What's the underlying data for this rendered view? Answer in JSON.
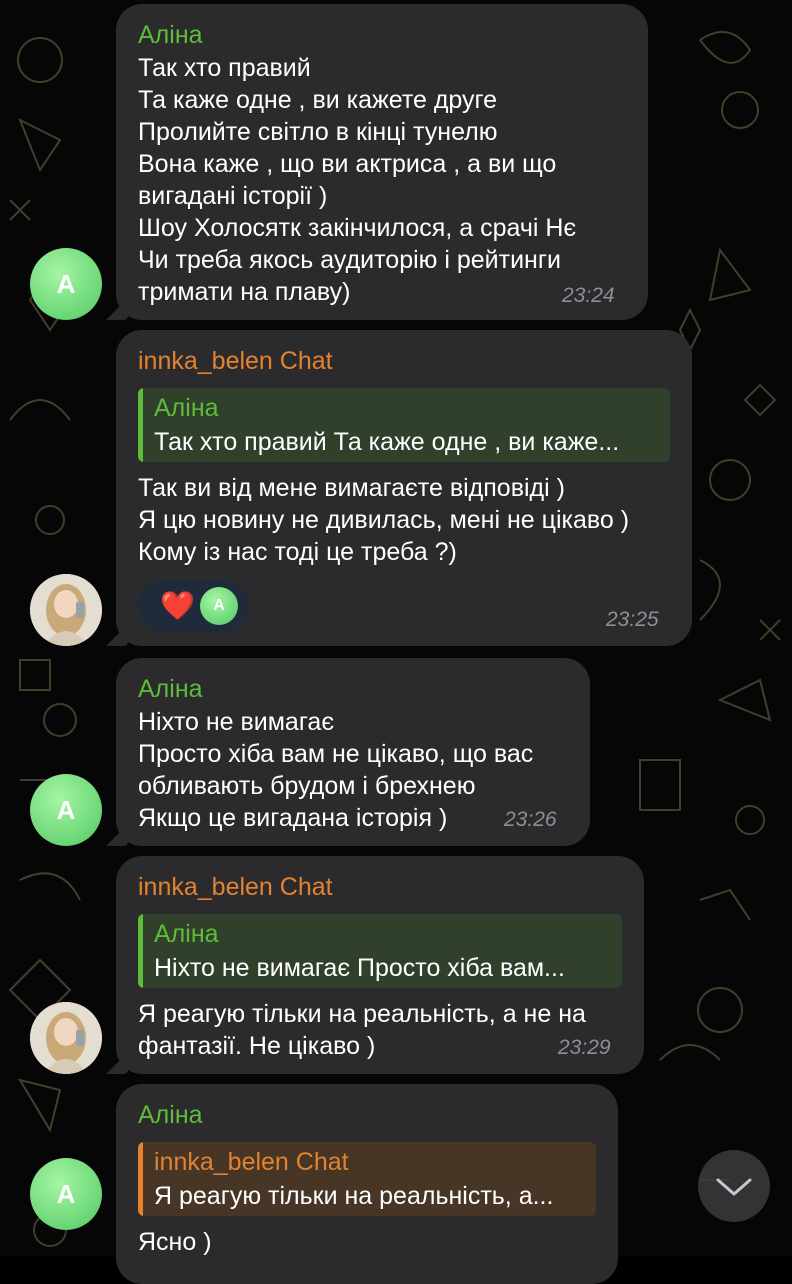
{
  "messages": [
    {
      "sender": "Аліна",
      "lines": [
        "Так хто правий",
        "Та каже одне , ви кажете друге",
        "Пролийте світло в кінці тунелю",
        "Вона каже , що ви актриса , а ви що",
        "вигадані історії )",
        "Шоу Холосятк  закінчилося, а срачі Нє",
        "Чи треба якось аудиторію і рейтинги",
        "тримати на плаву)"
      ],
      "time": "23:24",
      "avatar_letter": "A"
    },
    {
      "sender": "innka_belen Chat",
      "reply": {
        "name": "Аліна",
        "text": "Так хто правий Та каже одне , ви каже..."
      },
      "lines": [
        "Так ви від мене вимагаєте відповіді )",
        "Я цю новину не дивилась, мені не цікаво )",
        "Кому із нас тоді це треба ?)"
      ],
      "reaction": {
        "emoji": "❤️",
        "avatar_letter": "A"
      },
      "time": "23:25"
    },
    {
      "sender": "Аліна",
      "lines": [
        "Ніхто не вимагає",
        "Просто хіба вам не цікаво, що вас",
        "обливають брудом і брехнею",
        "Якщо це вигадана історія )"
      ],
      "time": "23:26",
      "avatar_letter": "A"
    },
    {
      "sender": "innka_belen Chat",
      "reply": {
        "name": "Аліна",
        "text": "Ніхто не вимагає  Просто хіба вам..."
      },
      "lines": [
        "Я реагую тільки на реальність, а не на",
        "фантазії. Не цікаво )"
      ],
      "time": "23:29"
    },
    {
      "sender": "Аліна",
      "reply": {
        "name": "innka_belen Chat",
        "text": "Я реагую тільки на реальність, а..."
      },
      "lines": [
        "Ясно )"
      ],
      "avatar_letter": "A"
    }
  ],
  "colors": {
    "bubble": "#2b2b2d",
    "sender_alina": "#5fbb3a",
    "sender_innka": "#e3822f",
    "time": "#8e8e93"
  },
  "icons": {
    "scroll_down": "chevron-down-icon",
    "heart": "heart-icon"
  }
}
